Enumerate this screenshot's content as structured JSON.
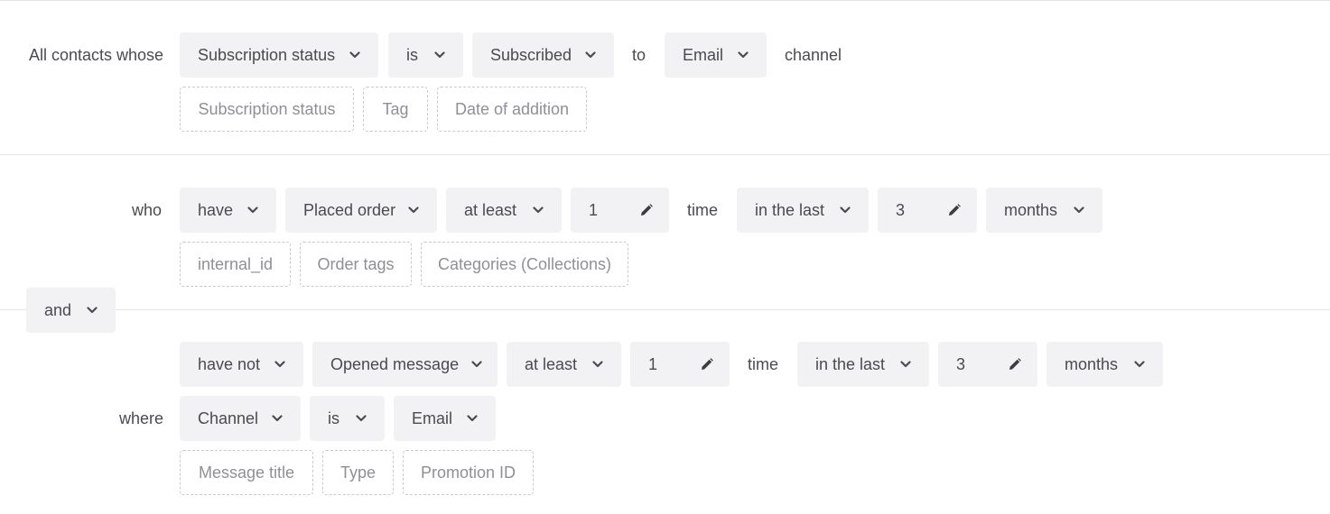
{
  "rule1": {
    "prefix": "All contacts whose",
    "field": "Subscription status",
    "operator": "is",
    "value": "Subscribed",
    "connector": "to",
    "channel": "Email",
    "suffix": "channel",
    "chips": [
      "Subscription status",
      "Tag",
      "Date of addition"
    ]
  },
  "combinator": "and",
  "rule2": {
    "prefix": "who",
    "verb": "have",
    "event": "Placed order",
    "quantifier": "at least",
    "count": "1",
    "unit": "time",
    "period": "in the last",
    "period_value": "3",
    "period_unit": "months",
    "chips": [
      "internal_id",
      "Order tags",
      "Categories (Collections)"
    ]
  },
  "rule3": {
    "verb": "have not",
    "event": "Opened message",
    "quantifier": "at least",
    "count": "1",
    "unit": "time",
    "period": "in the last",
    "period_value": "3",
    "period_unit": "months",
    "where_label": "where",
    "where_field": "Channel",
    "where_operator": "is",
    "where_value": "Email",
    "chips": [
      "Message title",
      "Type",
      "Promotion ID"
    ]
  },
  "icons": {
    "dropdown": "chevron-down-icon",
    "edit": "pencil-icon"
  }
}
